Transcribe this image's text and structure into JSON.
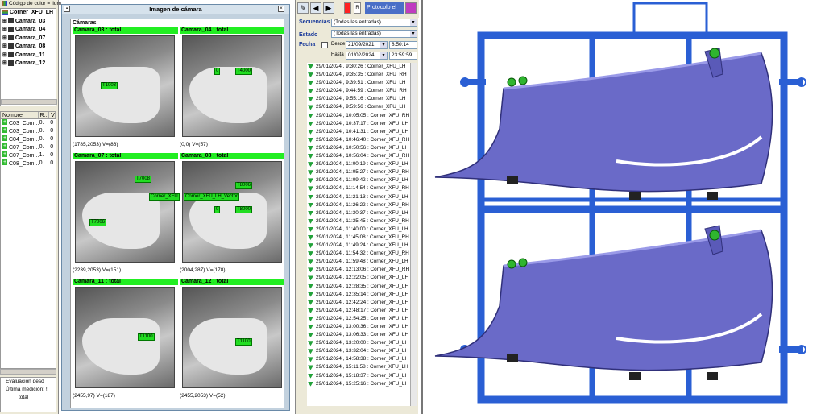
{
  "tree": {
    "header": "Código de color = llum",
    "root": "Corner_XFU_LH",
    "cameras": [
      "Camara_03",
      "Camara_04",
      "Camara_07",
      "Camara_08",
      "Camara_11",
      "Camara_12"
    ]
  },
  "table": {
    "headers": [
      "Nombre",
      "R..",
      "V"
    ],
    "rows": [
      [
        "C03_Com...",
        "0.",
        "0"
      ],
      [
        "C03_Com...",
        "0.",
        "0"
      ],
      [
        "C04_Com...",
        "0.",
        "0"
      ],
      [
        "C07_Com...",
        "0.",
        "0"
      ],
      [
        "C07_Com...",
        "1.",
        "0"
      ],
      [
        "C08_Com...",
        "0.",
        "0"
      ]
    ]
  },
  "evaluation": {
    "line1": "Evaluación desd",
    "line2": "Última medición: !",
    "line3": "total"
  },
  "camera_panel": {
    "title": "Imagen de cámara",
    "section": "Cámaras",
    "cells": [
      {
        "bar": "Camara_03 : total",
        "caption": "(1785,2053)  V=(86)",
        "tags": [
          "T1003"
        ]
      },
      {
        "bar": "Camara_04 : total",
        "caption": "(0,0)  V=(57)",
        "tags": [
          "T4000",
          "0"
        ]
      },
      {
        "bar": "Camara_07 : total",
        "caption": "(2239,2053)  V=(151)",
        "tags": [
          "T7008",
          "Corner_XFU",
          "T7006"
        ]
      },
      {
        "bar": "Camara_08 : total",
        "caption": "(2004,287)  V=(178)",
        "tags": [
          "T8006",
          "Corner_XFU_LH_Vector",
          "T8000",
          "0"
        ]
      },
      {
        "bar": "Camara_11 : total",
        "caption": "(2455,97)  V=(187)",
        "tags": [
          "T1100"
        ]
      },
      {
        "bar": "Camara_12 : total",
        "caption": "(2455,2053)  V=(52)",
        "tags": [
          "T1100"
        ]
      }
    ]
  },
  "filters": {
    "toolbar_title": "Protocolo el",
    "secuencias_label": "Secuencias",
    "secuencias_value": "(Todas las entradas)",
    "estado_label": "Estado",
    "estado_value": "(Todas las entradas)",
    "fecha_label": "Fecha",
    "desde_label": "Desde",
    "desde_date": "21/09/2021",
    "desde_time": "8:50:14",
    "hasta_label": "Hasta",
    "hasta_date": "01/02/2024",
    "hasta_time": "23:59:59"
  },
  "entries": [
    "29/01/2024 , 9:30:26 : Corner_XFU_LH",
    "29/01/2024 , 9:35:35 : Corner_XFU_RH",
    "29/01/2024 , 9:39:51 : Corner_XFU_LH",
    "29/01/2024 , 9:44:59 : Corner_XFU_RH",
    "29/01/2024 , 9:55:16 : Corner_XFU_LH",
    "29/01/2024 , 9:59:56 : Corner_XFU_LH",
    "29/01/2024 , 10:05:05 : Corner_XFU_RH",
    "29/01/2024 , 10:37:17 : Corner_XFU_LH",
    "29/01/2024 , 10:41:31 : Corner_XFU_LH",
    "29/01/2024 , 10:46:40 : Corner_XFU_RH",
    "29/01/2024 , 10:50:56 : Corner_XFU_LH",
    "29/01/2024 , 10:56:04 : Corner_XFU_RH",
    "29/01/2024 , 11:00:19 : Corner_XFU_LH",
    "29/01/2024 , 11:05:27 : Corner_XFU_RH",
    "29/01/2024 , 11:09:42 : Corner_XFU_LH",
    "29/01/2024 , 11:14:54 : Corner_XFU_RH",
    "29/01/2024 , 11:21:13 : Corner_XFU_LH",
    "29/01/2024 , 11:26:22 : Corner_XFU_RH",
    "29/01/2024 , 11:30:37 : Corner_XFU_LH",
    "29/01/2024 , 11:35:45 : Corner_XFU_RH",
    "29/01/2024 , 11:40:00 : Corner_XFU_LH",
    "29/01/2024 , 11:45:08 : Corner_XFU_RH",
    "29/01/2024 , 11:49:24 : Corner_XFU_LH",
    "29/01/2024 , 11:54:32 : Corner_XFU_RH",
    "29/01/2024 , 11:59:48 : Corner_XFU_LH",
    "29/01/2024 , 12:13:06 : Corner_XFU_RH",
    "29/01/2024 , 12:22:05 : Corner_XFU_LH",
    "29/01/2024 , 12:28:35 : Corner_XFU_LH",
    "29/01/2024 , 12:35:14 : Corner_XFU_LH",
    "29/01/2024 , 12:42:24 : Corner_XFU_LH",
    "29/01/2024 , 12:48:17 : Corner_XFU_LH",
    "29/01/2024 , 12:54:25 : Corner_XFU_LH",
    "29/01/2024 , 13:00:36 : Corner_XFU_LH",
    "29/01/2024 , 13:06:33 : Corner_XFU_LH",
    "29/01/2024 , 13:20:00 : Corner_XFU_LH",
    "29/01/2024 , 13:32:04 : Corner_XFU_LH",
    "29/01/2024 , 14:58:38 : Corner_XFU_LH",
    "29/01/2024 , 15:11:58 : Corner_XFU_LH",
    "29/01/2024 , 15:18:37 : Corner_XFU_LH",
    "29/01/2024 , 15:25:16 : Corner_XFU_LH"
  ],
  "colors": {
    "ok": "#22ee22",
    "frame": "#2a5fd4",
    "part": "#6a6ac8",
    "ok_marker": "#2fb52f"
  }
}
